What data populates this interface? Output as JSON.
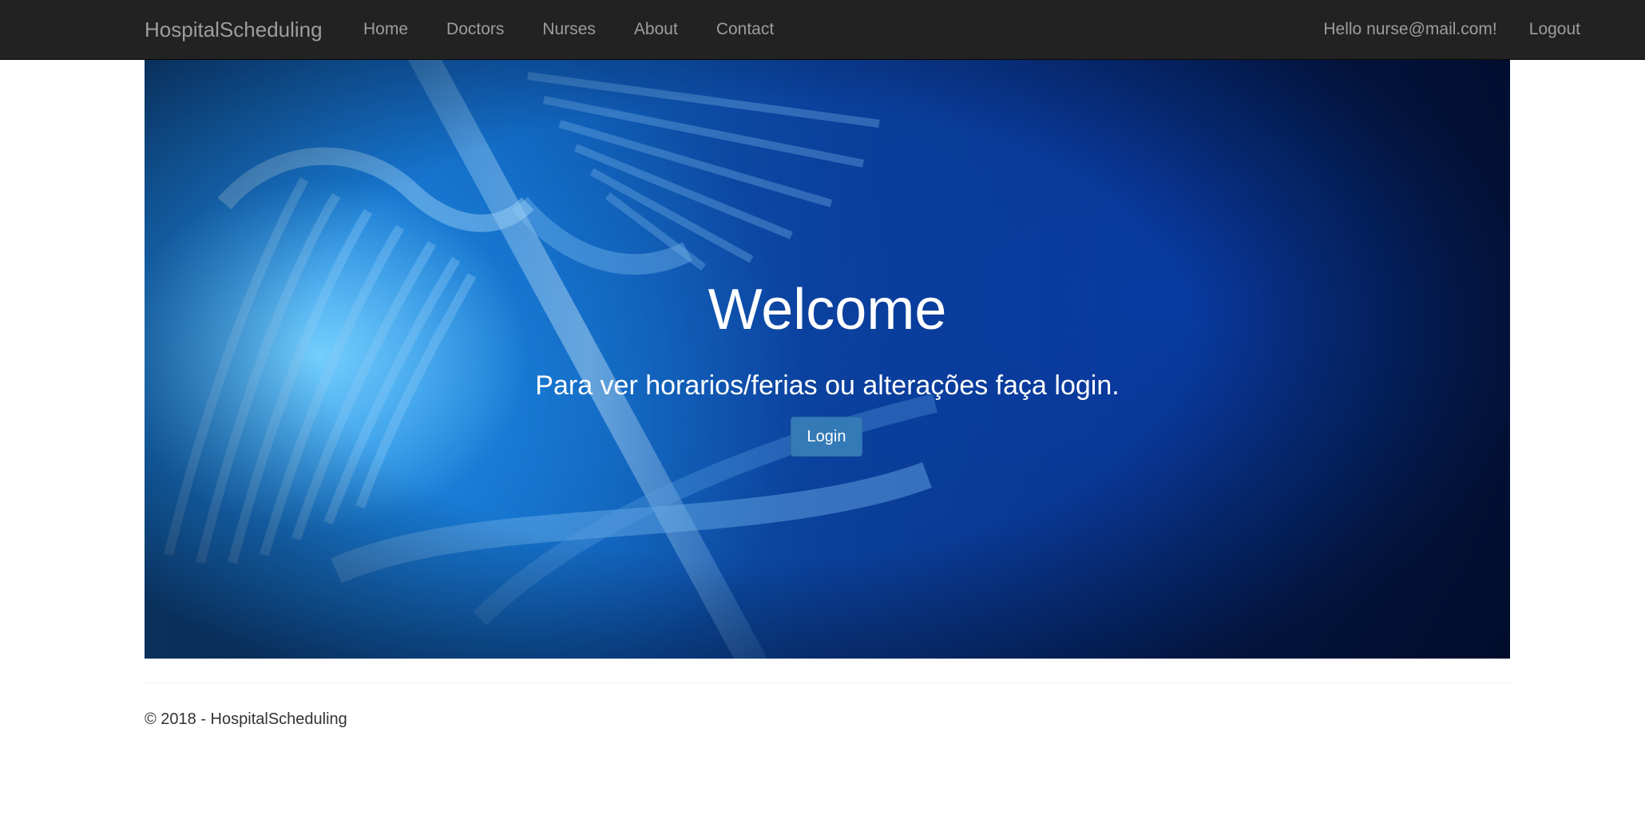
{
  "navbar": {
    "brand": "HospitalScheduling",
    "links": [
      "Home",
      "Doctors",
      "Nurses",
      "About",
      "Contact"
    ],
    "greeting": "Hello nurse@mail.com!",
    "logout": "Logout"
  },
  "hero": {
    "title": "Welcome",
    "subtitle": "Para ver horarios/ferias ou alterações faça login.",
    "login_label": "Login"
  },
  "footer": {
    "text": "© 2018 - HospitalScheduling"
  },
  "colors": {
    "navbar_bg": "#222222",
    "nav_text": "#9d9d9d",
    "primary_button": "#337ab7"
  }
}
